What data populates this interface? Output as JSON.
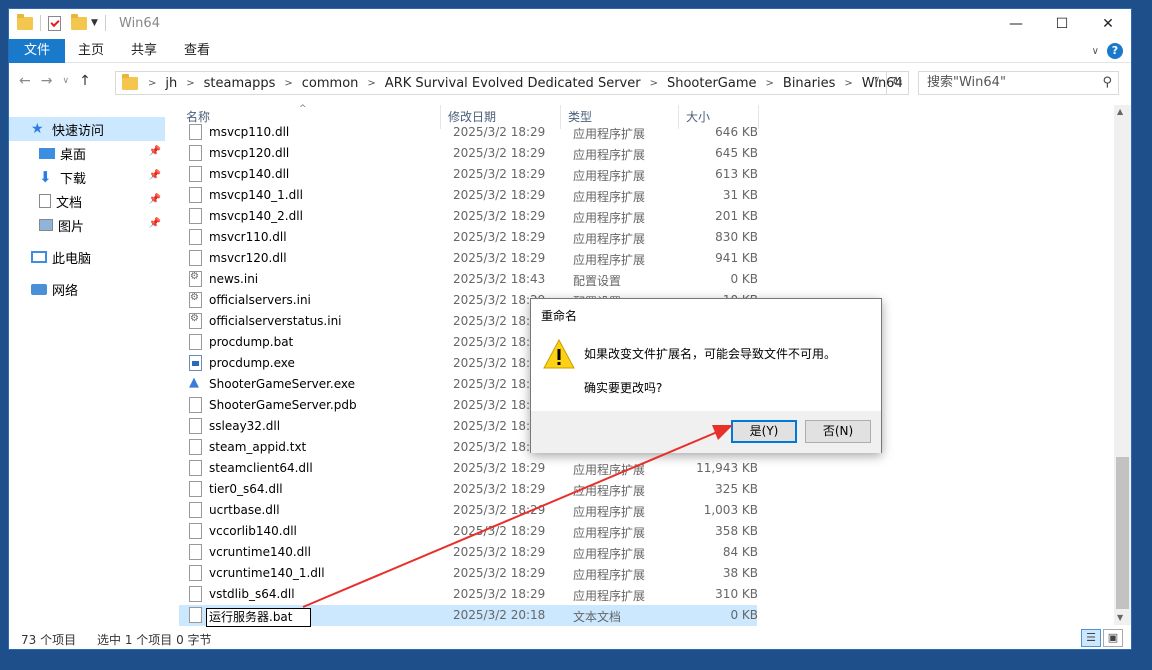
{
  "window": {
    "title": "Win64",
    "file_tab": "文件",
    "tabs": [
      "主页",
      "共享",
      "查看"
    ]
  },
  "address": {
    "crumbs": [
      "jh",
      "steamapps",
      "common",
      "ARK Survival Evolved Dedicated Server",
      "ShooterGame",
      "Binaries",
      "Win64"
    ],
    "search_placeholder": "搜索\"Win64\""
  },
  "sidebar": {
    "items": [
      {
        "label": "快速访问",
        "icon": "star-icon"
      },
      {
        "label": "桌面",
        "icon": "desktop-icon"
      },
      {
        "label": "下载",
        "icon": "download-icon"
      },
      {
        "label": "文档",
        "icon": "document-icon"
      },
      {
        "label": "图片",
        "icon": "pictures-icon"
      },
      {
        "label": "此电脑",
        "icon": "computer-icon"
      },
      {
        "label": "网络",
        "icon": "network-icon"
      }
    ]
  },
  "columns": {
    "name": "名称",
    "date": "修改日期",
    "type": "类型",
    "size": "大小"
  },
  "files": [
    {
      "name": "msvcp110.dll",
      "date": "2025/3/2 18:29",
      "type": "应用程序扩展",
      "size": "646 KB",
      "icon": "dll"
    },
    {
      "name": "msvcp120.dll",
      "date": "2025/3/2 18:29",
      "type": "应用程序扩展",
      "size": "645 KB",
      "icon": "dll"
    },
    {
      "name": "msvcp140.dll",
      "date": "2025/3/2 18:29",
      "type": "应用程序扩展",
      "size": "613 KB",
      "icon": "dll"
    },
    {
      "name": "msvcp140_1.dll",
      "date": "2025/3/2 18:29",
      "type": "应用程序扩展",
      "size": "31 KB",
      "icon": "dll"
    },
    {
      "name": "msvcp140_2.dll",
      "date": "2025/3/2 18:29",
      "type": "应用程序扩展",
      "size": "201 KB",
      "icon": "dll"
    },
    {
      "name": "msvcr110.dll",
      "date": "2025/3/2 18:29",
      "type": "应用程序扩展",
      "size": "830 KB",
      "icon": "dll"
    },
    {
      "name": "msvcr120.dll",
      "date": "2025/3/2 18:29",
      "type": "应用程序扩展",
      "size": "941 KB",
      "icon": "dll"
    },
    {
      "name": "news.ini",
      "date": "2025/3/2 18:43",
      "type": "配置设置",
      "size": "0 KB",
      "icon": "ini"
    },
    {
      "name": "officialservers.ini",
      "date": "2025/3/2 18:29",
      "type": "配置设置",
      "size": "10 KB",
      "icon": "ini"
    },
    {
      "name": "officialserverstatus.ini",
      "date": "2025/3/2 18:43",
      "type": "",
      "size": "",
      "icon": "ini"
    },
    {
      "name": "procdump.bat",
      "date": "2025/3/2 18:29",
      "type": "",
      "size": "",
      "icon": "bat"
    },
    {
      "name": "procdump.exe",
      "date": "2025/3/2 18:29",
      "type": "",
      "size": "",
      "icon": "exe"
    },
    {
      "name": "ShooterGameServer.exe",
      "date": "2025/3/2 18:29",
      "type": "",
      "size": "",
      "icon": "ark"
    },
    {
      "name": "ShooterGameServer.pdb",
      "date": "2025/3/2 18:29",
      "type": "",
      "size": "",
      "icon": "file"
    },
    {
      "name": "ssleay32.dll",
      "date": "2025/3/2 18:29",
      "type": "",
      "size": "",
      "icon": "dll"
    },
    {
      "name": "steam_appid.txt",
      "date": "2025/3/2 18:29",
      "type": "",
      "size": "",
      "icon": "txt"
    },
    {
      "name": "steamclient64.dll",
      "date": "2025/3/2 18:29",
      "type": "应用程序扩展",
      "size": "11,943 KB",
      "icon": "dll"
    },
    {
      "name": "tier0_s64.dll",
      "date": "2025/3/2 18:29",
      "type": "应用程序扩展",
      "size": "325 KB",
      "icon": "dll"
    },
    {
      "name": "ucrtbase.dll",
      "date": "2025/3/2 18:29",
      "type": "应用程序扩展",
      "size": "1,003 KB",
      "icon": "dll"
    },
    {
      "name": "vccorlib140.dll",
      "date": "2025/3/2 18:29",
      "type": "应用程序扩展",
      "size": "358 KB",
      "icon": "dll"
    },
    {
      "name": "vcruntime140.dll",
      "date": "2025/3/2 18:29",
      "type": "应用程序扩展",
      "size": "84 KB",
      "icon": "dll"
    },
    {
      "name": "vcruntime140_1.dll",
      "date": "2025/3/2 18:29",
      "type": "应用程序扩展",
      "size": "38 KB",
      "icon": "dll"
    },
    {
      "name": "vstdlib_s64.dll",
      "date": "2025/3/2 18:29",
      "type": "应用程序扩展",
      "size": "310 KB",
      "icon": "dll"
    },
    {
      "name": "运行服务器.bat",
      "date": "2025/3/2 20:18",
      "type": "文本文档",
      "size": "0 KB",
      "icon": "txt",
      "renaming": true
    }
  ],
  "status": {
    "count": "73 个项目",
    "selection": "选中 1 个项目 0 字节"
  },
  "dialog": {
    "title": "重命名",
    "message": "如果改变文件扩展名，可能会导致文件不可用。",
    "question": "确实要更改吗?",
    "yes_label": "是(Y)",
    "no_label": "否(N)"
  },
  "colors": {
    "accent": "#1979ca",
    "selection": "#cce8ff",
    "arrow": "#e8302a"
  }
}
